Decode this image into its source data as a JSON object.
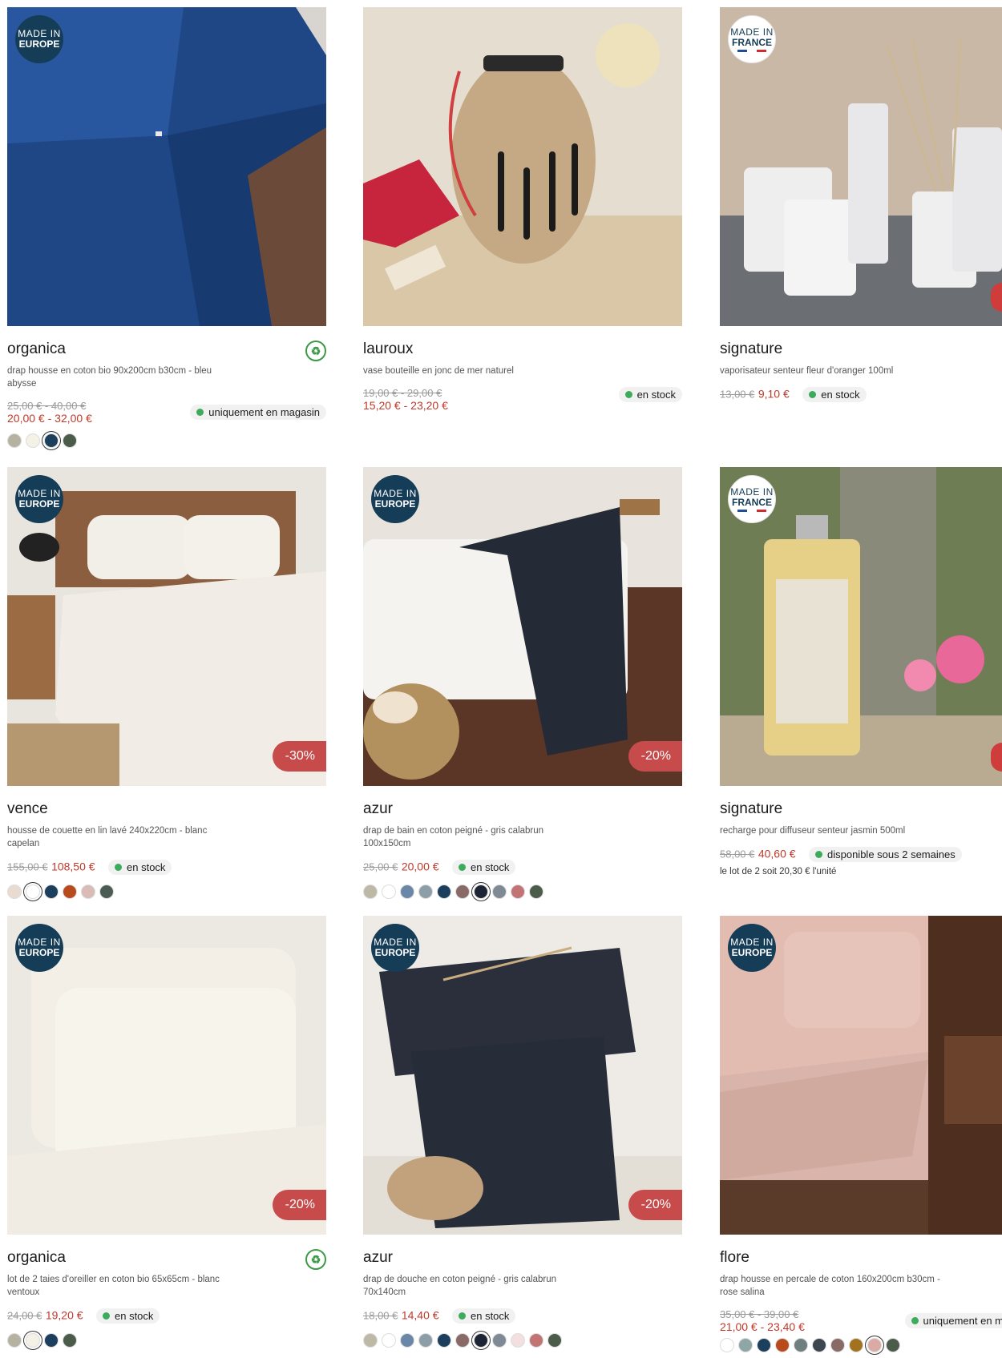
{
  "products": [
    {
      "name": "organica",
      "desc": "drap housse en coton bio 90x200cm b30cm - bleu abysse",
      "badge": "MADE IN EUROPE",
      "badge_l1": "MADE IN",
      "badge_l2": "EUROPE",
      "old_price": "25,00 € - 40,00 €",
      "new_price": "20,00 € - 32,00 €",
      "stock": "uniquement en magasin",
      "bio": true,
      "swatches": [
        "#b6b2a2",
        "#f4f1e6",
        "#1b3f5c",
        "#4b5c4b"
      ],
      "selected": 2
    },
    {
      "name": "lauroux",
      "desc": "vase bouteille en jonc de mer naturel",
      "old_price": "19,00 € - 29,00 €",
      "new_price": "15,20 € - 23,20 €",
      "stock": "en stock",
      "swatches": []
    },
    {
      "name": "signature",
      "desc": "vaporisateur senteur fleur d'oranger 100ml",
      "badge_l1": "MADE IN",
      "badge_l2": "FRANCE",
      "old_price": "13,00 €",
      "new_price": "9,10 €",
      "stock": "en stock",
      "swatches": []
    },
    {
      "name": "vence",
      "desc": "housse de couette en lin lavé 240x220cm - blanc capelan",
      "badge_l1": "MADE IN",
      "badge_l2": "EUROPE",
      "discount": "-30%",
      "old_price": "155,00 €",
      "new_price": "108,50 €",
      "stock": "en stock",
      "swatches": [
        "#eadbd0",
        "#ffffff",
        "#1b3f5c",
        "#b84a1c",
        "#d9bcb5",
        "#4b5c55"
      ],
      "selected": 1
    },
    {
      "name": "azur",
      "desc": "drap de bain en coton peigné - gris calabrun 100x150cm",
      "badge_l1": "MADE IN",
      "badge_l2": "EUROPE",
      "discount": "-20%",
      "old_price": "25,00 €",
      "new_price": "20,00 €",
      "stock": "en stock",
      "swatches": [
        "#bdb9a6",
        "#ffffff",
        "#6a87a8",
        "#8c9ea8",
        "#1b3f5c",
        "#8a6a67",
        "#1d2433",
        "#7f8a94",
        "#c27474",
        "#4b5c4b"
      ],
      "selected": 6
    },
    {
      "name": "signature",
      "desc": "recharge pour diffuseur senteur jasmin 500ml",
      "badge_l1": "MADE IN",
      "badge_l2": "FRANCE",
      "old_price": "58,00 €",
      "new_price": "40,60 €",
      "stock": "disponible sous 2 semaines",
      "extra": "le lot de 2 soit 20,30 € l'unité",
      "swatches": []
    },
    {
      "name": "organica",
      "desc": "lot de 2 taies d'oreiller en coton bio 65x65cm - blanc ventoux",
      "badge_l1": "MADE IN",
      "badge_l2": "EUROPE",
      "discount": "-20%",
      "old_price": "24,00 €",
      "new_price": "19,20 €",
      "stock": "en stock",
      "bio": true,
      "swatches": [
        "#b6b2a2",
        "#f4f1e6",
        "#1b3f5c",
        "#4b5c4b"
      ],
      "selected": 1
    },
    {
      "name": "azur",
      "desc": "drap de douche en coton peigné - gris calabrun 70x140cm",
      "badge_l1": "MADE IN",
      "badge_l2": "EUROPE",
      "discount": "-20%",
      "old_price": "18,00 €",
      "new_price": "14,40 €",
      "stock": "en stock",
      "swatches": [
        "#bdb9a6",
        "#ffffff",
        "#6a87a8",
        "#8c9ea8",
        "#1b3f5c",
        "#8a6a67",
        "#1d2433",
        "#7f8a94",
        "#f4dfe0",
        "#c27474",
        "#4b5c4b"
      ],
      "selected": 6
    },
    {
      "name": "flore",
      "desc": "drap housse en percale de coton 160x200cm b30cm - rose salina",
      "badge_l1": "MADE IN",
      "badge_l2": "EUROPE",
      "old_price": "35,00 € - 39,00 €",
      "new_price": "21,00 € - 23,40 €",
      "stock": "uniquement en m",
      "swatches": [
        "#ffffff",
        "#8fa6a6",
        "#1b3f5c",
        "#b84a1c",
        "#6f7f7f",
        "#3d4750",
        "#8a6a67",
        "#a3721f",
        "#d9aba4",
        "#4b5c4b"
      ],
      "selected": 8
    }
  ],
  "colors": {
    "accent_red": "#c0392b",
    "navy_badge": "#163d57",
    "stock_green": "#3cab5b"
  }
}
